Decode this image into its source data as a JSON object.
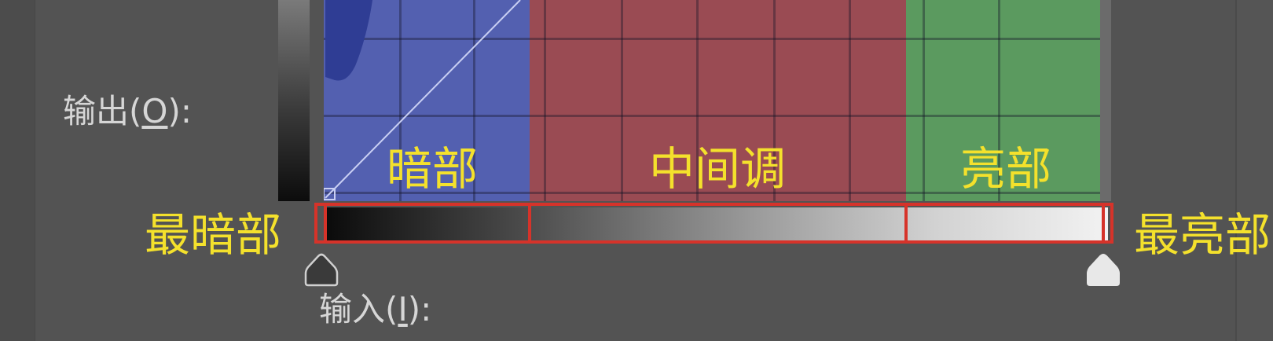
{
  "levels": {
    "output_label": "输出(",
    "output_mnemonic": "O",
    "output_suffix": "):",
    "input_label": "输入(",
    "input_mnemonic": "I",
    "input_suffix": "):"
  },
  "zones": {
    "dark": "暗部",
    "mid": "中间调",
    "light": "亮部"
  },
  "annotations": {
    "darkest": "最暗部",
    "brightest": "最亮部"
  },
  "colors": {
    "shadows": "#5360b0",
    "midtones": "#9a4b53",
    "highlights": "#5b9a5f",
    "annotation_text": "#f4e12c",
    "box_outline": "#d6332a"
  },
  "icons": {
    "black_point": "black-point-slider-icon",
    "white_point": "white-point-slider-icon"
  }
}
